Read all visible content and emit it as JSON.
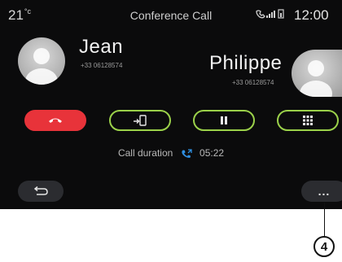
{
  "status_bar": {
    "temperature": "21",
    "temperature_unit": "°c",
    "title": "Conference Call",
    "clock": "12:00"
  },
  "participants": [
    {
      "name": "Jean",
      "number": "+33 06128574"
    },
    {
      "name": "Philippe",
      "number": "+33 06128574"
    }
  ],
  "controls": {
    "hangup_icon": "hang-up-icon",
    "transfer_icon": "transfer-to-phone-icon",
    "pause_icon": "pause-icon",
    "keypad_icon": "keypad-icon"
  },
  "call_info": {
    "label": "Call duration",
    "duration": "05:22"
  },
  "bottom": {
    "back_icon": "back-arrow-icon",
    "more_label": "...",
    "callout_number": "4"
  },
  "colors": {
    "accent_green": "#9bd14a",
    "hangup_red": "#e8333a",
    "phone_blue": "#2f8fe0"
  }
}
